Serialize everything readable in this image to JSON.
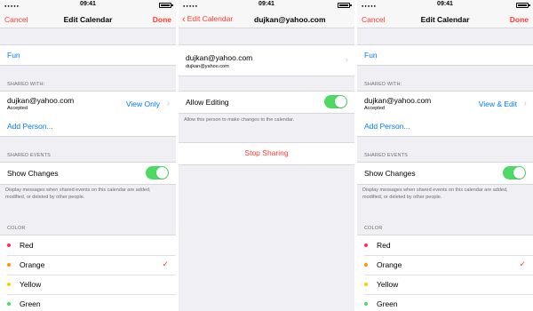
{
  "status": {
    "time": "09:41"
  },
  "screen1": {
    "nav": {
      "left": "Cancel",
      "title": "Edit Calendar",
      "right": "Done"
    },
    "calendar_name": "Fun",
    "shared_with_header": "SHARED WITH:",
    "user": {
      "email": "dujkan@yahoo.com",
      "status": "Accepted",
      "permission": "View Only"
    },
    "add_person": "Add Person...",
    "shared_events_header": "SHARED EVENTS",
    "show_changes": "Show Changes",
    "show_changes_on": true,
    "shared_events_footer": "Display messages when shared events on this calendar are added, modified, or deleted by other people.",
    "color_header": "COLOR",
    "colors": [
      {
        "name": "Red",
        "hex": "#ff2d55",
        "selected": false
      },
      {
        "name": "Orange",
        "hex": "#ff9500",
        "selected": true
      },
      {
        "name": "Yellow",
        "hex": "#ffcc00",
        "selected": false
      },
      {
        "name": "Green",
        "hex": "#4cd964",
        "selected": false
      }
    ]
  },
  "screen2": {
    "nav": {
      "back": "Edit Calendar",
      "title": "dujkan@yahoo.com"
    },
    "user": {
      "email": "dujkan@yahoo.com",
      "email_small": "dujkan@yahoo.com"
    },
    "allow_editing": "Allow Editing",
    "allow_editing_on": true,
    "allow_editing_footer": "Allow this person to make changes to the calendar.",
    "stop_sharing": "Stop Sharing"
  },
  "screen3": {
    "nav": {
      "left": "Cancel",
      "title": "Edit Calendar",
      "right": "Done"
    },
    "calendar_name": "Fun",
    "shared_with_header": "SHARED WITH:",
    "user": {
      "email": "dujkan@yahoo.com",
      "status": "Accepted",
      "permission": "View & Edit"
    },
    "add_person": "Add Person...",
    "shared_events_header": "SHARED EVENTS",
    "show_changes": "Show Changes",
    "show_changes_on": true,
    "shared_events_footer": "Display messages when shared events on this calendar are added, modified, or deleted by other people.",
    "color_header": "COLOR",
    "colors": [
      {
        "name": "Red",
        "hex": "#ff2d55",
        "selected": false
      },
      {
        "name": "Orange",
        "hex": "#ff9500",
        "selected": true
      },
      {
        "name": "Yellow",
        "hex": "#ffcc00",
        "selected": false
      },
      {
        "name": "Green",
        "hex": "#4cd964",
        "selected": false
      }
    ]
  },
  "theme": {
    "accent": "#ff3b30",
    "link": "#007aff",
    "toggle_on": "#4cd964"
  }
}
